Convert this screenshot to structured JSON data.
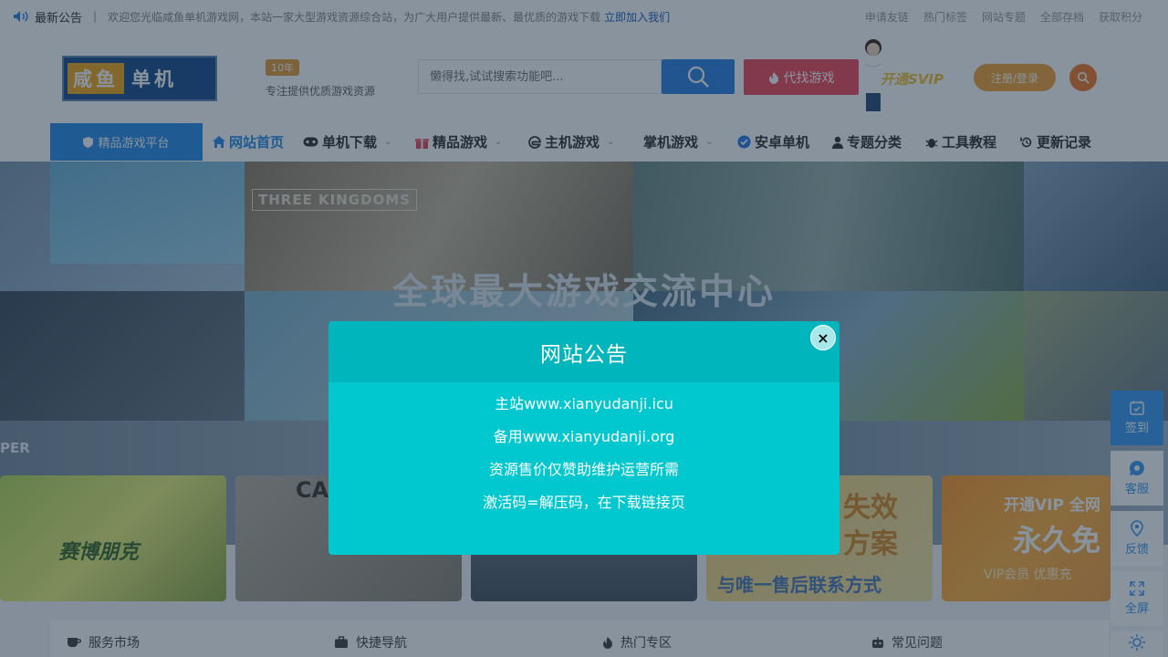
{
  "topbar": {
    "label": "最新公告",
    "separator": "|",
    "notice": "欢迎您光临咸鱼单机游戏网，本站一家大型游戏资源综合站，为广大用户提供最新、最优质的游戏下载",
    "link": "立即加入我们",
    "links": [
      "申请友链",
      "热门标签",
      "网站专题",
      "全部存档",
      "获取积分"
    ]
  },
  "header": {
    "logo_part1": "咸鱼",
    "logo_part2": "单机",
    "badge": "10年",
    "tagline": "专注提供优质游戏资源",
    "search_placeholder": "懒得找,试试搜索功能吧...",
    "find_button": "代找游戏",
    "svip": "开通SVIP",
    "login_button": "注册/登录"
  },
  "nav": {
    "platform": "精品游戏平台",
    "items": [
      {
        "label": "网站首页",
        "icon": "home-icon"
      },
      {
        "label": "单机下载",
        "icon": "gamepad-icon"
      },
      {
        "label": "精品游戏",
        "icon": "gift-icon"
      },
      {
        "label": "主机游戏",
        "icon": "edge-icon"
      },
      {
        "label": "掌机游戏",
        "icon": "handheld-icon"
      },
      {
        "label": "安卓单机",
        "icon": "check-badge-icon"
      },
      {
        "label": "专题分类",
        "icon": "user-icon"
      },
      {
        "label": "工具教程",
        "icon": "bug-icon"
      },
      {
        "label": "更新记录",
        "icon": "history-icon"
      }
    ]
  },
  "banner": {
    "title": "全球最大游戏交流中心",
    "poster_title": "THREE KINGDOMS",
    "side_label": "PER"
  },
  "cards": [
    {
      "text": "赛博朋克"
    },
    {
      "text": "CALL"
    },
    {
      "text": ""
    },
    {
      "line1": "失效",
      "line2": "方案",
      "line3": "与唯一售后联系方式"
    },
    {
      "line1": "开通VIP 全网",
      "line2": "永久免",
      "line3": "VIP会员 优惠充"
    }
  ],
  "services": [
    "服务市场",
    "快捷导航",
    "热门专区",
    "常见问题"
  ],
  "side": {
    "checkin": "签到",
    "service": "客服",
    "feedback": "反馈",
    "fullscreen": "全屏"
  },
  "modal": {
    "title": "网站公告",
    "close": "×",
    "lines": [
      "主站www.xianyudanji.icu",
      "备用www.xianyudanji.org",
      "资源售价仅赞助维护运营所需",
      "激活码=解压码，在下载链接页"
    ]
  }
}
